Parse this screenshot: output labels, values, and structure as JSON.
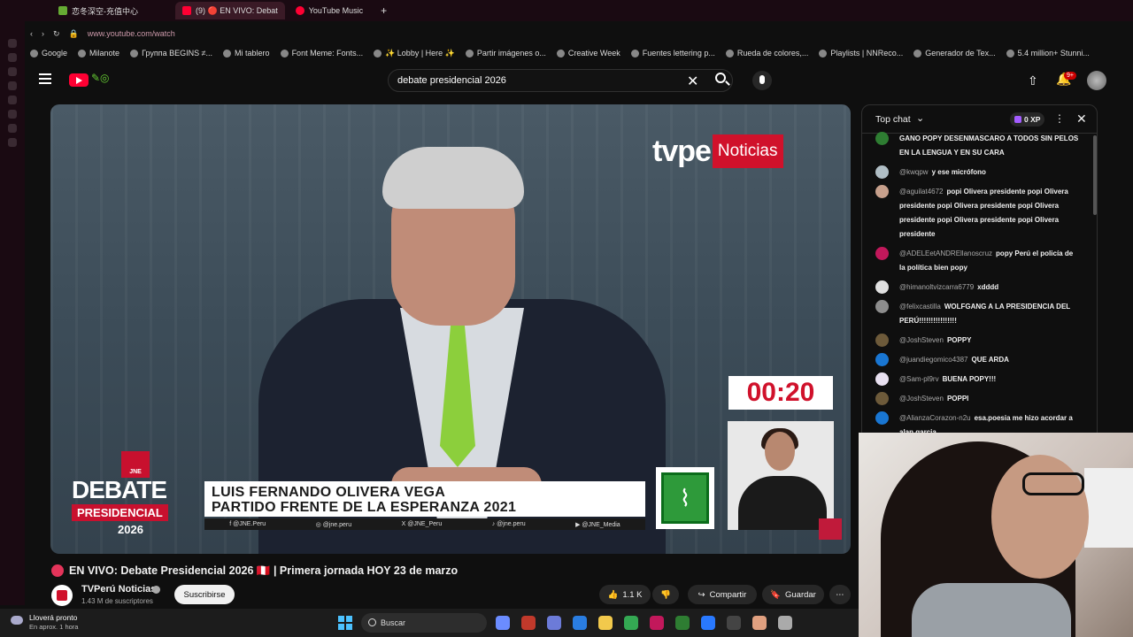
{
  "browser": {
    "tabs": [
      {
        "label": "恋冬深空-充值中心",
        "color": "#6a3"
      },
      {
        "label": "(9) 🔴 EN VIVO: Debat",
        "color": "#ff0033",
        "active": true
      },
      {
        "label": "YouTube Music",
        "color": "#ff0033"
      }
    ],
    "new_tab": "+",
    "url": "www.youtube.com/watch",
    "bookmarks": [
      "Google",
      "Milanote",
      "Группа BEGINS ≠...",
      "Mi tablero",
      "Font Meme: Fonts...",
      "✨ Lobby | Here ✨",
      "Partir imágenes o...",
      "Creative Week",
      "Fuentes lettering p...",
      "Rueda de colores,...",
      "Playlists | NNReco...",
      "Generador de Tex...",
      "5.4 million+ Stunni..."
    ]
  },
  "youtube": {
    "search_value": "debate presidencial 2026",
    "notifications": "9+"
  },
  "player": {
    "tvpe_brand": "tvpe",
    "tvpe_label": "Noticias",
    "timer": "00:20",
    "jne_badge": "JNE",
    "debate_line1": "DEBATE",
    "debate_line2": "PRESIDENCIAL",
    "debate_year": "2026",
    "candidate_name": "LUIS FERNANDO OLIVERA VEGA",
    "candidate_party": "PARTIDO FRENTE DE LA ESPERANZA 2021",
    "socials": [
      "f  @JNE.Peru",
      "◎  @jne.peru",
      "X  @JNE_Peru",
      "♪  @jne.peru",
      "▶  @JNE_Media"
    ]
  },
  "video": {
    "title": "EN VIVO: Debate Presidencial 2026 🇵🇪 | Primera jornada HOY 23 de marzo",
    "channel": "TVPerú Noticias",
    "subscribers": "1.43 M de suscriptores",
    "subscribe_label": "Suscribirse",
    "likes": "1.1 K",
    "share_label": "Compartir",
    "save_label": "Guardar"
  },
  "chat": {
    "title": "Top chat",
    "xp": "0 XP",
    "messages": [
      {
        "author": "",
        "text": "GANO POPY DESENMASCARO A TODOS SIN PELOS EN LA LENGUA Y EN SU CARA",
        "color": "#2e7d32"
      },
      {
        "author": "@kwqpw",
        "text": "y ese micrófono",
        "color": "#b0bec5"
      },
      {
        "author": "@aguilat4672",
        "text": "popi Olivera presidente popi Olivera presidente popi Olivera presidente popi Olivera presidente popi Olivera presidente popi Olivera presidente",
        "color": "#c7a08c"
      },
      {
        "author": "@ADELEetANDREllanoscruz",
        "text": "popy Perú el policía de la política bien popy",
        "color": "#c2185b"
      },
      {
        "author": "@himanoltvizcarra6779",
        "text": "xdddd",
        "color": "#e0e0e0"
      },
      {
        "author": "@felixcastilla",
        "text": "WOLFGANG A LA PRESIDENCIA DEL PERÚ!!!!!!!!!!!!!!!!",
        "color": "#8d8d8d"
      },
      {
        "author": "@JoshSteven",
        "text": "POPPY",
        "color": "#6d5a3a"
      },
      {
        "author": "@juandiegomico4387",
        "text": "QUE ARDA",
        "color": "#1976d2"
      },
      {
        "author": "@Sam-pl9rv",
        "text": "BUENA POPY!!!",
        "color": "#e8e0f0"
      },
      {
        "author": "@JoshSteven",
        "text": "POPPI",
        "color": "#6d5a3a"
      },
      {
        "author": "@AlianzaCorazon-n2u",
        "text": "esa.poesia me hizo acordar a alan garcia",
        "color": "#1976d2"
      }
    ]
  },
  "taskbar": {
    "weather_title": "Lloverá pronto",
    "weather_sub": "En aprox. 1 hora",
    "search_label": "Buscar"
  }
}
